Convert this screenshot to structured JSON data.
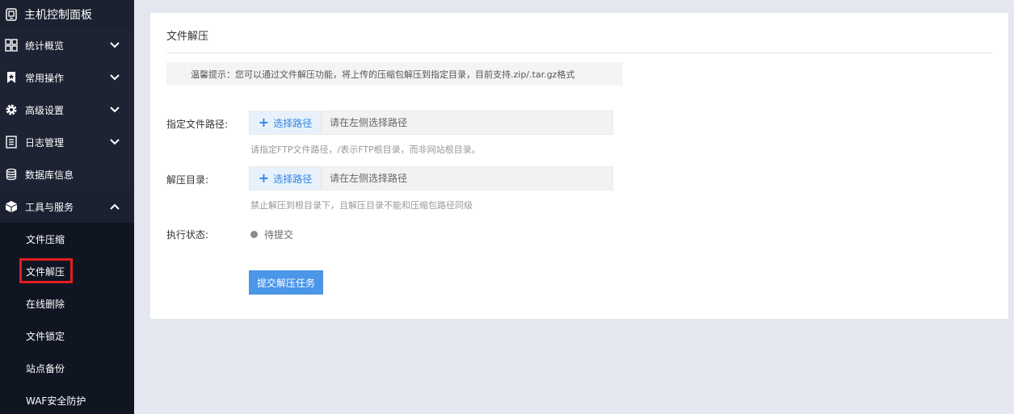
{
  "sidebar": {
    "title": "主机控制面板",
    "title_icon": "panel-icon",
    "items": [
      {
        "label": "统计概览",
        "icon": "grid-icon",
        "expanded": false
      },
      {
        "label": "常用操作",
        "icon": "bookmark-icon",
        "expanded": false
      },
      {
        "label": "高级设置",
        "icon": "gear-icon",
        "expanded": false
      },
      {
        "label": "日志管理",
        "icon": "log-icon",
        "expanded": false
      },
      {
        "label": "数据库信息",
        "icon": "database-icon"
      },
      {
        "label": "工具与服务",
        "icon": "box-icon",
        "expanded": true
      }
    ],
    "sub_items": [
      {
        "label": "文件压缩"
      },
      {
        "label": "文件解压",
        "active": true
      },
      {
        "label": "在线删除"
      },
      {
        "label": "文件锁定"
      },
      {
        "label": "站点备份"
      },
      {
        "label": "WAF安全防护"
      }
    ]
  },
  "main": {
    "title": "文件解压",
    "tip": "温馨提示：您可以通过文件解压功能，将上传的压缩包解压到指定目录，目前支持.zip/.tar.gz格式",
    "file_path": {
      "label": "指定文件路径:",
      "button_label": "选择路径",
      "placeholder": "请在左侧选择路径",
      "hint": "请指定FTP文件路径，/表示FTP根目录，而非网站根目录。"
    },
    "extract_dir": {
      "label": "解压目录:",
      "button_label": "选择路径",
      "placeholder": "请在左侧选择路径",
      "hint": "禁止解压到根目录下，且解压目录不能和压缩包路径同级"
    },
    "status": {
      "label": "执行状态:",
      "value": "待提交"
    },
    "submit_label": "提交解压任务"
  },
  "colors": {
    "sidebar_bg": "#1d2332",
    "submenu_bg": "#101522",
    "accent": "#4a96e9",
    "link_blue": "#2f86e6",
    "highlight_border": "#e21e1e",
    "page_bg": "#e4e7ef"
  }
}
